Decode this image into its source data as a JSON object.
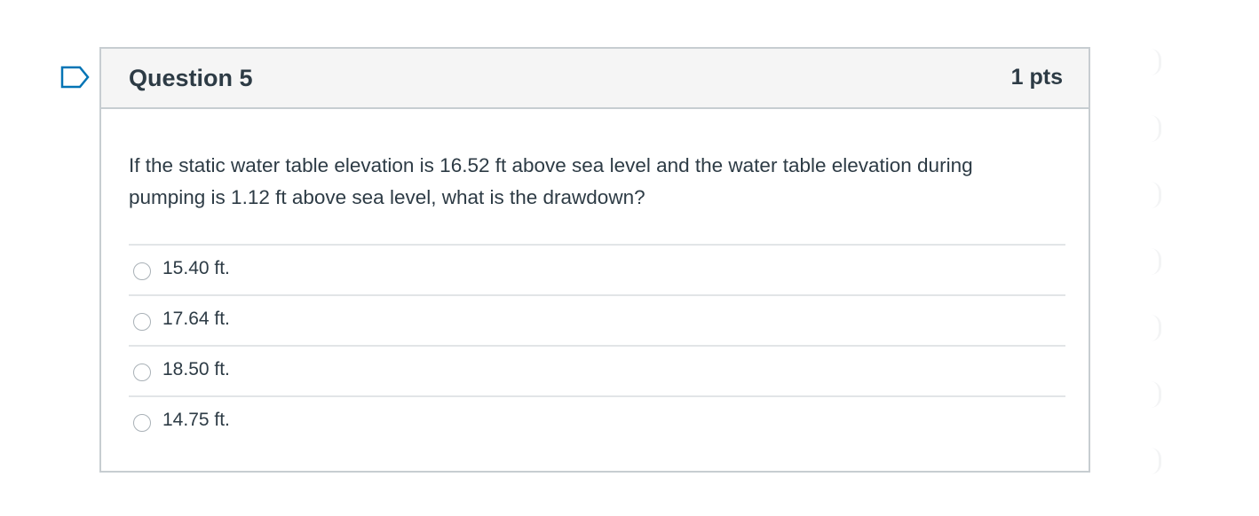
{
  "question": {
    "title": "Question 5",
    "points": "1 pts",
    "text": "If the static water table elevation is 16.52 ft above sea level and the water table elevation during pumping is 1.12 ft above sea level, what is the drawdown?",
    "answers": [
      {
        "label": "15.40 ft."
      },
      {
        "label": "17.64 ft."
      },
      {
        "label": "18.50 ft."
      },
      {
        "label": "14.75 ft."
      }
    ]
  },
  "colors": {
    "flag": "#0374b5",
    "border": "#c7cdd1",
    "header_bg": "#f5f5f5",
    "text": "#2d3b45"
  },
  "icons": {
    "flag": "flag-question-icon",
    "answer_radio": "radio-button"
  }
}
